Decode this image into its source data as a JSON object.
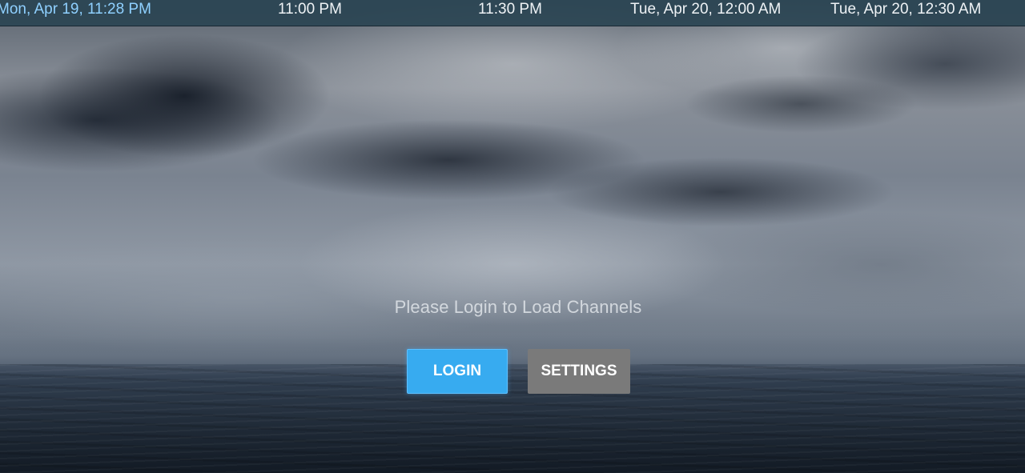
{
  "timebar": {
    "current_time": "Mon, Apr 19, 11:28 PM",
    "slots": [
      "11:00 PM",
      "11:30 PM",
      "Tue, Apr 20, 12:00 AM",
      "Tue, Apr 20, 12:30 AM"
    ]
  },
  "main": {
    "message": "Please Login to Load Channels",
    "login_label": "LOGIN",
    "settings_label": "SETTINGS"
  },
  "colors": {
    "timebar_bg": "#2a4452",
    "current_time_text": "#8fd0ff",
    "login_button": "#37abf0",
    "settings_button": "#7a7a7a"
  }
}
